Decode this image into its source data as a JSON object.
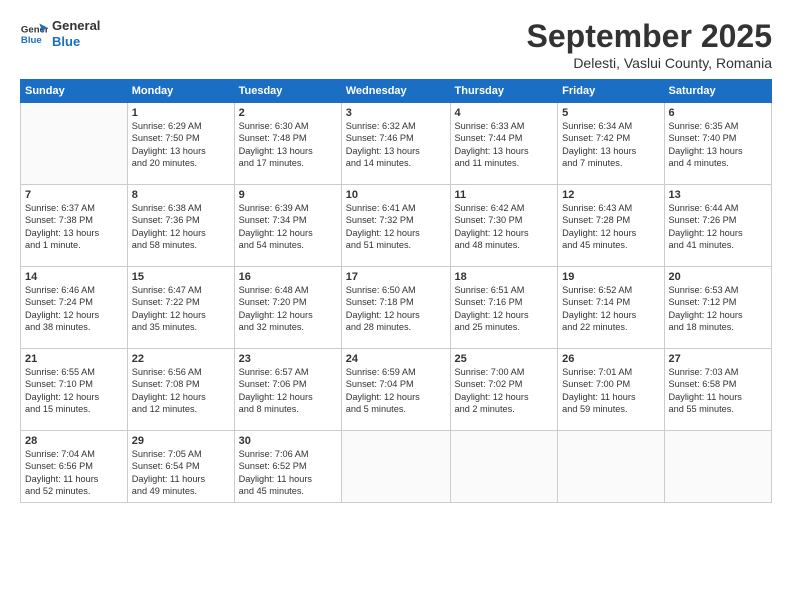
{
  "header": {
    "logo_line1": "General",
    "logo_line2": "Blue",
    "month": "September 2025",
    "location": "Delesti, Vaslui County, Romania"
  },
  "weekdays": [
    "Sunday",
    "Monday",
    "Tuesday",
    "Wednesday",
    "Thursday",
    "Friday",
    "Saturday"
  ],
  "weeks": [
    [
      {
        "day": "",
        "info": ""
      },
      {
        "day": "1",
        "info": "Sunrise: 6:29 AM\nSunset: 7:50 PM\nDaylight: 13 hours\nand 20 minutes."
      },
      {
        "day": "2",
        "info": "Sunrise: 6:30 AM\nSunset: 7:48 PM\nDaylight: 13 hours\nand 17 minutes."
      },
      {
        "day": "3",
        "info": "Sunrise: 6:32 AM\nSunset: 7:46 PM\nDaylight: 13 hours\nand 14 minutes."
      },
      {
        "day": "4",
        "info": "Sunrise: 6:33 AM\nSunset: 7:44 PM\nDaylight: 13 hours\nand 11 minutes."
      },
      {
        "day": "5",
        "info": "Sunrise: 6:34 AM\nSunset: 7:42 PM\nDaylight: 13 hours\nand 7 minutes."
      },
      {
        "day": "6",
        "info": "Sunrise: 6:35 AM\nSunset: 7:40 PM\nDaylight: 13 hours\nand 4 minutes."
      }
    ],
    [
      {
        "day": "7",
        "info": "Sunrise: 6:37 AM\nSunset: 7:38 PM\nDaylight: 13 hours\nand 1 minute."
      },
      {
        "day": "8",
        "info": "Sunrise: 6:38 AM\nSunset: 7:36 PM\nDaylight: 12 hours\nand 58 minutes."
      },
      {
        "day": "9",
        "info": "Sunrise: 6:39 AM\nSunset: 7:34 PM\nDaylight: 12 hours\nand 54 minutes."
      },
      {
        "day": "10",
        "info": "Sunrise: 6:41 AM\nSunset: 7:32 PM\nDaylight: 12 hours\nand 51 minutes."
      },
      {
        "day": "11",
        "info": "Sunrise: 6:42 AM\nSunset: 7:30 PM\nDaylight: 12 hours\nand 48 minutes."
      },
      {
        "day": "12",
        "info": "Sunrise: 6:43 AM\nSunset: 7:28 PM\nDaylight: 12 hours\nand 45 minutes."
      },
      {
        "day": "13",
        "info": "Sunrise: 6:44 AM\nSunset: 7:26 PM\nDaylight: 12 hours\nand 41 minutes."
      }
    ],
    [
      {
        "day": "14",
        "info": "Sunrise: 6:46 AM\nSunset: 7:24 PM\nDaylight: 12 hours\nand 38 minutes."
      },
      {
        "day": "15",
        "info": "Sunrise: 6:47 AM\nSunset: 7:22 PM\nDaylight: 12 hours\nand 35 minutes."
      },
      {
        "day": "16",
        "info": "Sunrise: 6:48 AM\nSunset: 7:20 PM\nDaylight: 12 hours\nand 32 minutes."
      },
      {
        "day": "17",
        "info": "Sunrise: 6:50 AM\nSunset: 7:18 PM\nDaylight: 12 hours\nand 28 minutes."
      },
      {
        "day": "18",
        "info": "Sunrise: 6:51 AM\nSunset: 7:16 PM\nDaylight: 12 hours\nand 25 minutes."
      },
      {
        "day": "19",
        "info": "Sunrise: 6:52 AM\nSunset: 7:14 PM\nDaylight: 12 hours\nand 22 minutes."
      },
      {
        "day": "20",
        "info": "Sunrise: 6:53 AM\nSunset: 7:12 PM\nDaylight: 12 hours\nand 18 minutes."
      }
    ],
    [
      {
        "day": "21",
        "info": "Sunrise: 6:55 AM\nSunset: 7:10 PM\nDaylight: 12 hours\nand 15 minutes."
      },
      {
        "day": "22",
        "info": "Sunrise: 6:56 AM\nSunset: 7:08 PM\nDaylight: 12 hours\nand 12 minutes."
      },
      {
        "day": "23",
        "info": "Sunrise: 6:57 AM\nSunset: 7:06 PM\nDaylight: 12 hours\nand 8 minutes."
      },
      {
        "day": "24",
        "info": "Sunrise: 6:59 AM\nSunset: 7:04 PM\nDaylight: 12 hours\nand 5 minutes."
      },
      {
        "day": "25",
        "info": "Sunrise: 7:00 AM\nSunset: 7:02 PM\nDaylight: 12 hours\nand 2 minutes."
      },
      {
        "day": "26",
        "info": "Sunrise: 7:01 AM\nSunset: 7:00 PM\nDaylight: 11 hours\nand 59 minutes."
      },
      {
        "day": "27",
        "info": "Sunrise: 7:03 AM\nSunset: 6:58 PM\nDaylight: 11 hours\nand 55 minutes."
      }
    ],
    [
      {
        "day": "28",
        "info": "Sunrise: 7:04 AM\nSunset: 6:56 PM\nDaylight: 11 hours\nand 52 minutes."
      },
      {
        "day": "29",
        "info": "Sunrise: 7:05 AM\nSunset: 6:54 PM\nDaylight: 11 hours\nand 49 minutes."
      },
      {
        "day": "30",
        "info": "Sunrise: 7:06 AM\nSunset: 6:52 PM\nDaylight: 11 hours\nand 45 minutes."
      },
      {
        "day": "",
        "info": ""
      },
      {
        "day": "",
        "info": ""
      },
      {
        "day": "",
        "info": ""
      },
      {
        "day": "",
        "info": ""
      }
    ]
  ]
}
